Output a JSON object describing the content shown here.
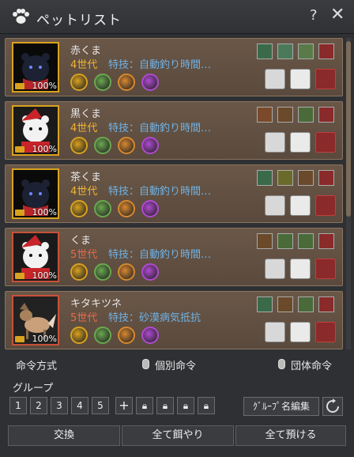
{
  "window": {
    "title": "ペットリスト",
    "help": "?",
    "close": "✕"
  },
  "pets": [
    {
      "name": "赤くま",
      "generation": "4世代",
      "gen_color": "gold",
      "skill": "特技：自動釣り時間…",
      "hunger": "100%",
      "portrait": "black-bear-red-scarf"
    },
    {
      "name": "黒くま",
      "generation": "4世代",
      "gen_color": "gold",
      "skill": "特技：自動釣り時間…",
      "hunger": "100%",
      "portrait": "white-bear-santa"
    },
    {
      "name": "茶くま",
      "generation": "4世代",
      "gen_color": "gold",
      "skill": "特技：自動釣り時間…",
      "hunger": "100%",
      "portrait": "black-bear-red-scarf"
    },
    {
      "name": "くま",
      "generation": "5世代",
      "gen_color": "red",
      "skill": "特技：自動釣り時間…",
      "hunger": "100%",
      "portrait": "white-bear-santa"
    },
    {
      "name": "キタキツネ",
      "generation": "5世代",
      "gen_color": "red",
      "skill": "特技：砂漠病気抵抗",
      "hunger": "100%",
      "portrait": "fox"
    }
  ],
  "command": {
    "label": "命令方式",
    "individual": "個別命令",
    "group": "団体命令"
  },
  "group": {
    "label": "グループ",
    "buttons": [
      "1",
      "2",
      "3",
      "4",
      "5"
    ],
    "rename": "ｸﾞﾙｰﾌﾟ名編集"
  },
  "footer": {
    "exchange": "交換",
    "feed_all": "全て餌やり",
    "store_all": "全て預ける"
  }
}
